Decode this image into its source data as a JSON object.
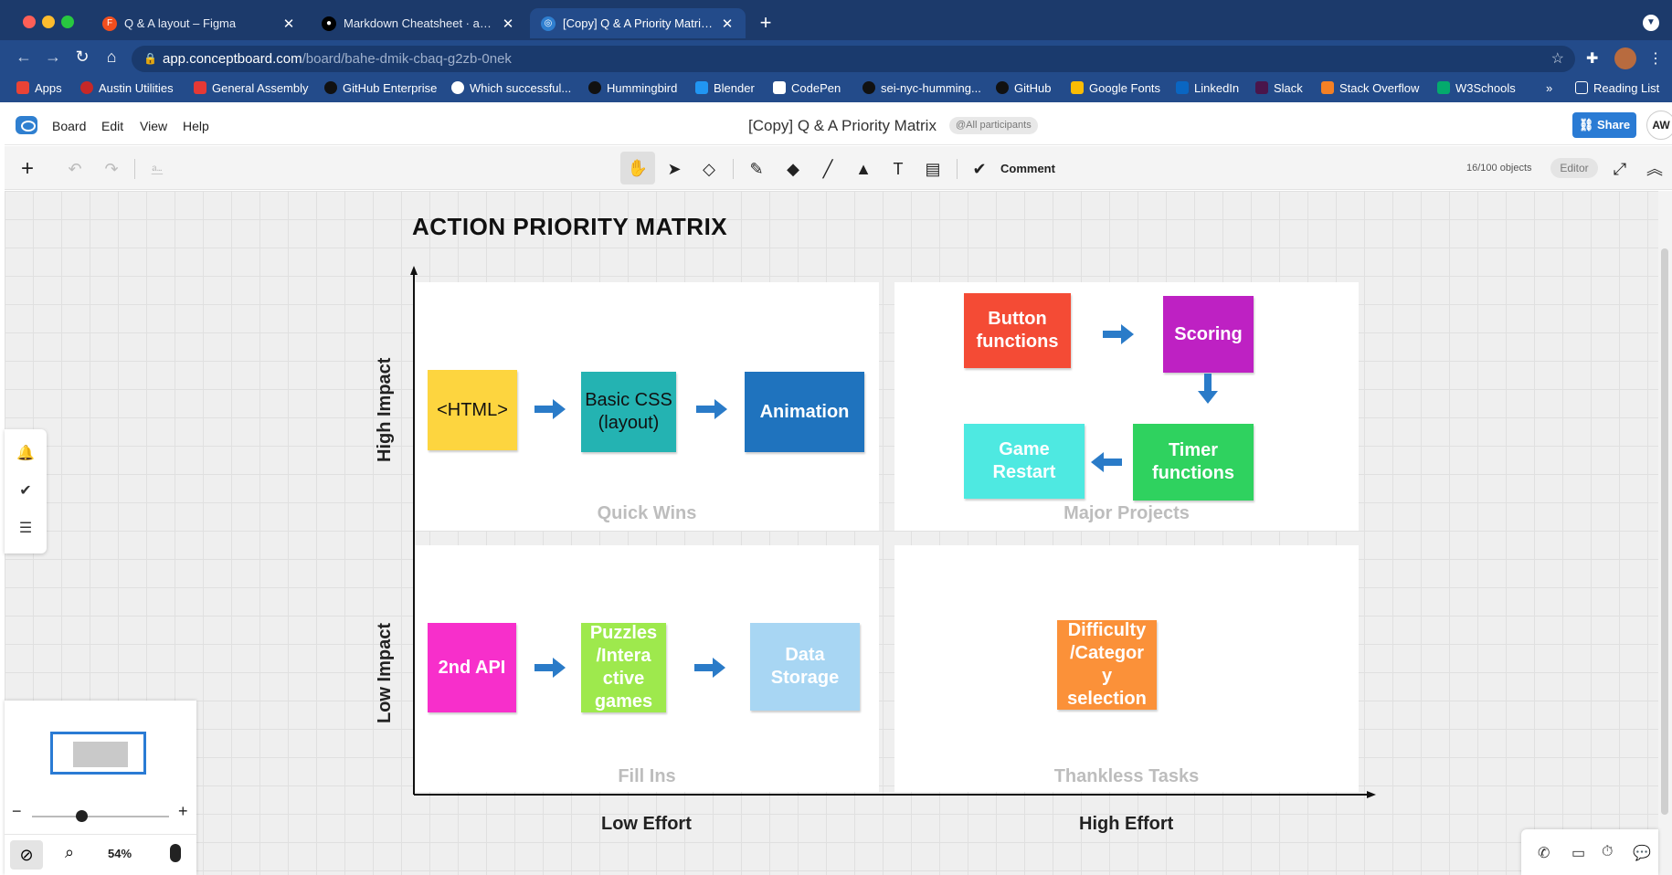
{
  "browser": {
    "tabs": [
      {
        "title": "Q & A layout – Figma",
        "icon": "figma-icon"
      },
      {
        "title": "Markdown Cheatsheet · adam-p",
        "icon": "github-icon"
      },
      {
        "title": "[Copy] Q & A Priority Matrix – C",
        "icon": "conceptboard-icon"
      }
    ],
    "url_host": "app.conceptboard.com",
    "url_path": "/board/bahe-dmik-cbaq-g2zb-0nek",
    "bookmarks": [
      "Apps",
      "Austin Utilities",
      "General Assembly",
      "GitHub Enterprise",
      "Which successful...",
      "Hummingbird",
      "Blender",
      "CodePen",
      "sei-nyc-humming...",
      "GitHub",
      "Google Fonts",
      "LinkedIn",
      "Slack",
      "Stack Overflow",
      "W3Schools"
    ],
    "more_bookmarks": "»",
    "reading_list": "Reading List"
  },
  "app": {
    "menu": [
      "Board",
      "Edit",
      "View",
      "Help"
    ],
    "title": "[Copy] Q & A Priority Matrix",
    "participants": "@All participants",
    "share": "Share",
    "user_initials": "AW",
    "comment_label": "Comment",
    "object_count": "16/100 objects",
    "mode": "Editor",
    "zoom": "54%"
  },
  "board": {
    "title": "ACTION PRIORITY MATRIX",
    "y_axis": {
      "high": "High Impact",
      "low": "Low Impact"
    },
    "x_axis": {
      "low": "Low Effort",
      "high": "High Effort"
    },
    "quadrants": {
      "quick_wins": "Quick Wins",
      "major_projects": "Major Projects",
      "fill_ins": "Fill Ins",
      "thankless": "Thankless Tasks"
    },
    "notes": {
      "html": "<HTML>",
      "basic_css_1": "Basic CSS",
      "basic_css_2": "(layout)",
      "animation": "Animation",
      "button_functions_1": "Button",
      "button_functions_2": "functions",
      "scoring": "Scoring",
      "game_restart_1": "Game",
      "game_restart_2": "Restart",
      "timer_functions_1": "Timer",
      "timer_functions_2": "functions",
      "second_api": "2nd API",
      "puzzles_1": "Puzzles",
      "puzzles_2": "/Intera",
      "puzzles_3": "ctive",
      "puzzles_4": "games",
      "data_storage_1": "Data",
      "data_storage_2": "Storage",
      "difficulty_1": "Difficulty",
      "difficulty_2": "/Categor",
      "difficulty_3": "y",
      "difficulty_4": "selection"
    }
  },
  "colors": {
    "yellow": "#fdd53f",
    "teal": "#24b3b2",
    "blue": "#1f73be",
    "red": "#f44b35",
    "magenta": "#be21c3",
    "cyan": "#4ee9e1",
    "green": "#2fd25f",
    "pink": "#f72fcb",
    "lime": "#9ee94d",
    "lightblue": "#a8d6f3",
    "orange": "#fb9139",
    "arrow": "#2a7bc8"
  }
}
